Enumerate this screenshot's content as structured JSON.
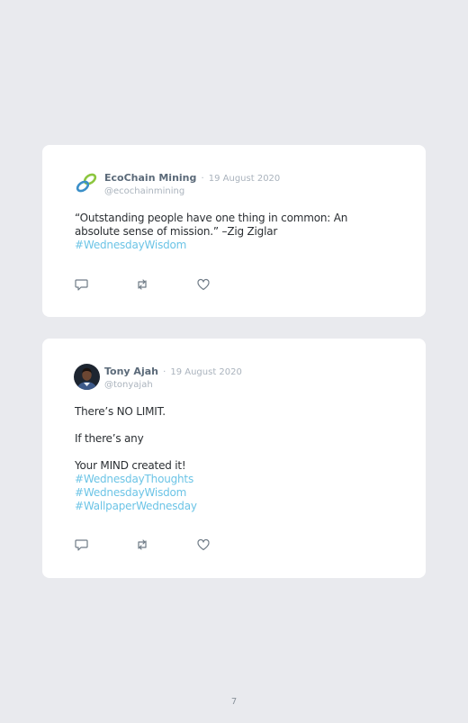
{
  "posts": [
    {
      "author": "EcoChain Mining",
      "separator": "·",
      "date": "19 August 2020",
      "handle": "@ecochainmining",
      "avatar_icon": "chain-link-logo-icon",
      "lines": [
        "“Outstanding people have one thing in common: An",
        "absolute sense of mission.” –Zig Ziglar"
      ],
      "hashtags": [
        "#WednesdayWisdom"
      ],
      "actions": [
        "comment-icon",
        "retweet-icon",
        "like-icon"
      ]
    },
    {
      "author": "Tony Ajah",
      "separator": "·",
      "date": "19 August 2020",
      "handle": "@tonyajah",
      "avatar_icon": "profile-photo",
      "paragraphs": [
        "There’s NO LIMIT.",
        "If there’s any",
        "Your MIND created it!"
      ],
      "hashtags": [
        "#WednesdayThoughts",
        "#WednesdayWisdom",
        "#WallpaperWednesday"
      ],
      "actions": [
        "comment-icon",
        "retweet-icon",
        "like-icon"
      ]
    }
  ],
  "colors": {
    "background": "#e9eaee",
    "card": "#ffffff",
    "hashtag": "#6cc4e6",
    "name": "#5b6a79",
    "meta": "#aab3bd"
  },
  "page_number": "7"
}
